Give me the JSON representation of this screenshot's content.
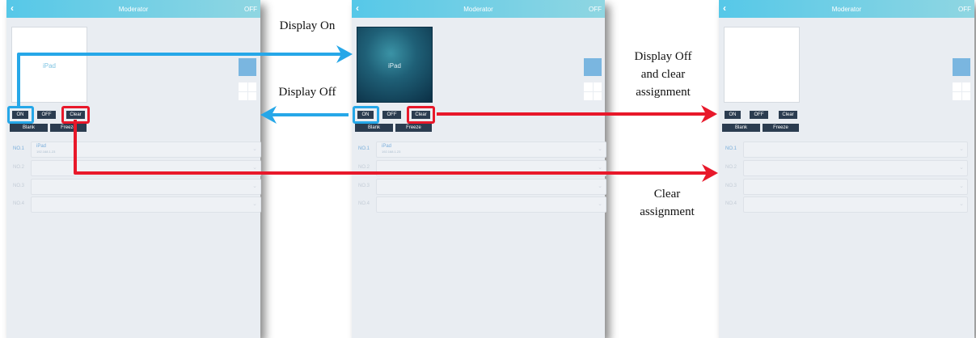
{
  "screens": [
    {
      "header": {
        "back_icon": "‹",
        "title": "Moderator",
        "status": "OFF"
      },
      "preview": {
        "label": "iPad",
        "style": "blank"
      },
      "buttons": {
        "on": "ON",
        "off": "OFF",
        "clear": "Clear",
        "blank": "Blank",
        "freeze": "Freeze"
      },
      "slots": [
        {
          "label": "NO.1",
          "name": "iPad",
          "ip": "192.168.1.23"
        },
        {
          "label": "NO.2"
        },
        {
          "label": "NO.3"
        },
        {
          "label": "NO.4"
        }
      ]
    },
    {
      "header": {
        "back_icon": "‹",
        "title": "Moderator",
        "status": "OFF"
      },
      "preview": {
        "label": "iPad",
        "style": "wallpaper"
      },
      "buttons": {
        "on": "ON",
        "off": "OFF",
        "clear": "Clear",
        "blank": "Blank",
        "freeze": "Freeze"
      },
      "slots": [
        {
          "label": "NO.1",
          "name": "iPad",
          "ip": "192.168.1.23"
        },
        {
          "label": "NO.2"
        },
        {
          "label": "NO.3"
        },
        {
          "label": "NO.4"
        }
      ]
    },
    {
      "header": {
        "back_icon": "‹",
        "title": "Moderator",
        "status": "OFF"
      },
      "preview": {
        "label": "",
        "style": "blank"
      },
      "buttons": {
        "on": "ON",
        "off": "OFF",
        "clear": "Clear",
        "blank": "Blank",
        "freeze": "Freeze"
      },
      "slots": [
        {
          "label": "NO.1"
        },
        {
          "label": "NO.2"
        },
        {
          "label": "NO.3"
        },
        {
          "label": "NO.4"
        }
      ]
    }
  ],
  "captions": {
    "display_on": "Display On",
    "display_off": "Display Off",
    "display_off_clear_line1": "Display Off",
    "display_off_clear_line2": "and clear",
    "display_off_clear_line3": "assignment",
    "clear_assignment_line1": "Clear",
    "clear_assignment_line2": "assignment"
  },
  "colors": {
    "blue_highlight": "#26a7e8",
    "red_highlight": "#e8182a",
    "header_gradient_start": "#56c8e8",
    "header_gradient_end": "#8fd6e2"
  }
}
